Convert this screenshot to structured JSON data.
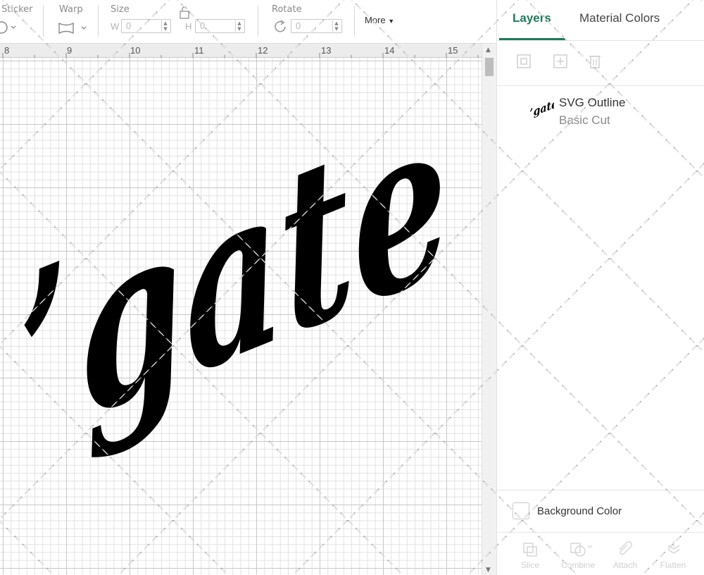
{
  "toolbar": {
    "sticker_label": "Sticker",
    "warp_label": "Warp",
    "size_label": "Size",
    "size_w_axis": "W",
    "size_w_value": "0",
    "size_h_axis": "H",
    "size_h_value": "0",
    "rotate_label": "Rotate",
    "rotate_value": "0",
    "more_label": "More"
  },
  "ruler": {
    "numbers": [
      "8",
      "9",
      "10",
      "11",
      "12",
      "13",
      "14",
      "15"
    ]
  },
  "canvas": {
    "design_text": "’gate",
    "design_color": "#000000"
  },
  "panel": {
    "tabs": [
      {
        "label": "Layers",
        "active": true
      },
      {
        "label": "Material Colors",
        "active": false
      }
    ],
    "layer_tools": [
      "group-icon",
      "add-layer-icon",
      "delete-icon"
    ],
    "layers": [
      {
        "name": "SVG Outline",
        "operation": "Basic Cut",
        "thumb_text": "’gate"
      }
    ],
    "background_color_label": "Background Color",
    "bottom_tools": [
      {
        "label": "Slice",
        "icon": "slice-icon"
      },
      {
        "label": "Combine",
        "icon": "combine-icon"
      },
      {
        "label": "Attach",
        "icon": "attach-icon"
      },
      {
        "label": "Flatten",
        "icon": "flatten-icon"
      }
    ]
  },
  "colors": {
    "accent": "#1f7a5c",
    "grid_major": "#c7c7c7",
    "grid_minor": "#e2e2e2"
  }
}
